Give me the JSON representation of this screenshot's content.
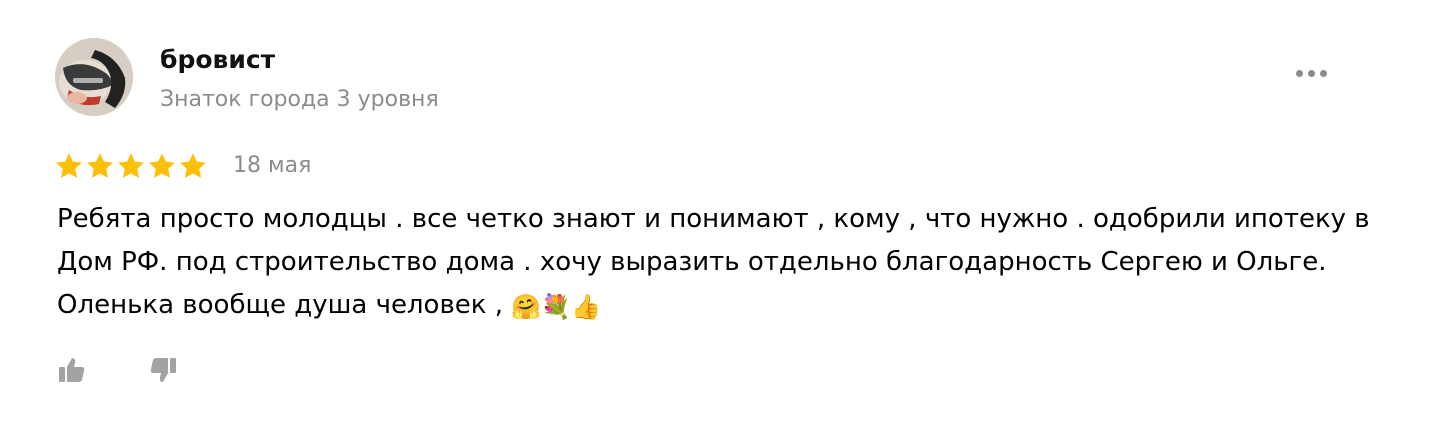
{
  "review": {
    "author": {
      "name": "бровист",
      "level": "Знаток города 3 уровня"
    },
    "rating": 5,
    "rating_color": "#fcc00b",
    "date": "18 мая",
    "text": "Ребята просто молодцы . все четко знают и понимают , кому , что нужно . одобрили ипотеку в Дом РФ. под строительство дома . хочу выразить отдельно благодарность Сергею и Ольге. Оленька вообще душа человек ,",
    "text_emojis": "🤗💐👍"
  },
  "icons": {
    "more": "more-dots-icon",
    "like": "thumbs-up-icon",
    "dislike": "thumbs-down-icon"
  }
}
